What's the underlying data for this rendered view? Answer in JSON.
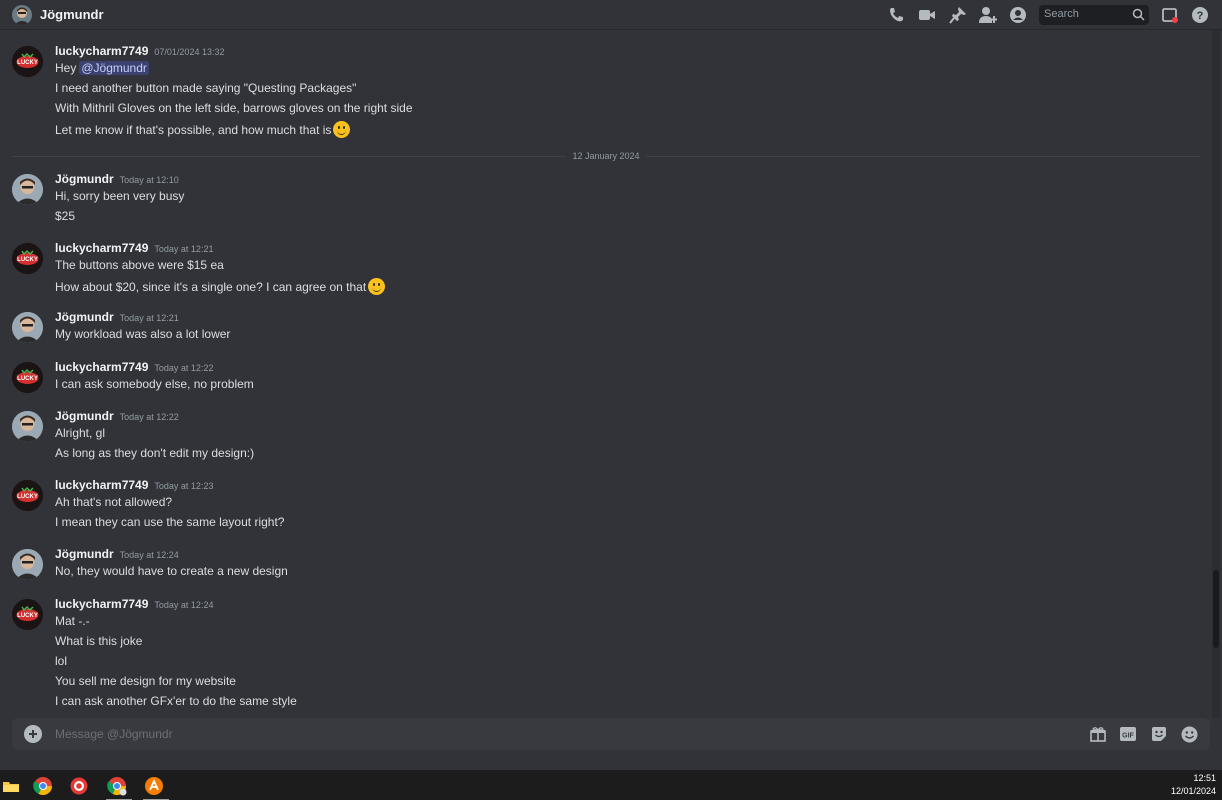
{
  "header": {
    "title": "Jögmundr",
    "search_placeholder": "Search",
    "icons": [
      "voice-call-icon",
      "video-call-icon",
      "pin-icon",
      "add-friend-icon",
      "user-profile-icon",
      "search-icon",
      "inbox-icon",
      "help-icon"
    ]
  },
  "dividers": {
    "date_new": "12 January 2024"
  },
  "messages": [
    {
      "author": "luckycharm7749",
      "time": "07/01/2024 13:32",
      "lines": [
        "Hey",
        "I need another button made saying \"Questing Packages\"",
        "With Mithril Gloves on the left side, barrows gloves on the right side",
        "Let me know if that's possible, and how much that is"
      ],
      "mention": "@Jögmundr"
    },
    {
      "author": "Jögmundr",
      "time": "Today at 12:10",
      "lines": [
        "Hi, sorry been very busy",
        "$25"
      ]
    },
    {
      "author": "luckycharm7749",
      "time": "Today at 12:21",
      "lines": [
        "The buttons above were $15 ea",
        "How about $20, since it's a single one? I can agree on that"
      ]
    },
    {
      "author": "Jögmundr",
      "time": "Today at 12:21",
      "lines": [
        "My workload was also a lot lower"
      ]
    },
    {
      "author": "luckycharm7749",
      "time": "Today at 12:22",
      "lines": [
        "I can ask somebody else, no problem"
      ]
    },
    {
      "author": "Jögmundr",
      "time": "Today at 12:22",
      "lines": [
        "Alright, gl",
        "As long as they don't edit my design:)"
      ]
    },
    {
      "author": "luckycharm7749",
      "time": "Today at 12:23",
      "lines": [
        "Ah that's not allowed?",
        "I mean they can use the same layout right?"
      ]
    },
    {
      "author": "Jögmundr",
      "time": "Today at 12:24",
      "lines": [
        "No, they would have to create a new design"
      ]
    },
    {
      "author": "luckycharm7749",
      "time": "Today at 12:24",
      "lines": [
        "Mat -.-",
        "What is this joke",
        "lol",
        "You sell me design for my website",
        "I can ask another GFx'er to do the same style"
      ]
    }
  ],
  "composer": {
    "placeholder": "Message @Jögmundr",
    "icons": [
      "add-attachment-icon",
      "gift-icon",
      "gif-icon",
      "sticker-icon",
      "emoji-icon"
    ]
  },
  "taskbar": {
    "apps": [
      "file-explorer-icon",
      "chrome-icon",
      "app-icon-red",
      "chrome-profile-icon",
      "app-icon-orange"
    ],
    "time": "12:51",
    "date": "12/01/2024"
  },
  "colors": {
    "background": "#313338",
    "accent_mention": "#3c4270",
    "taskbar": "#1c1c1c"
  }
}
